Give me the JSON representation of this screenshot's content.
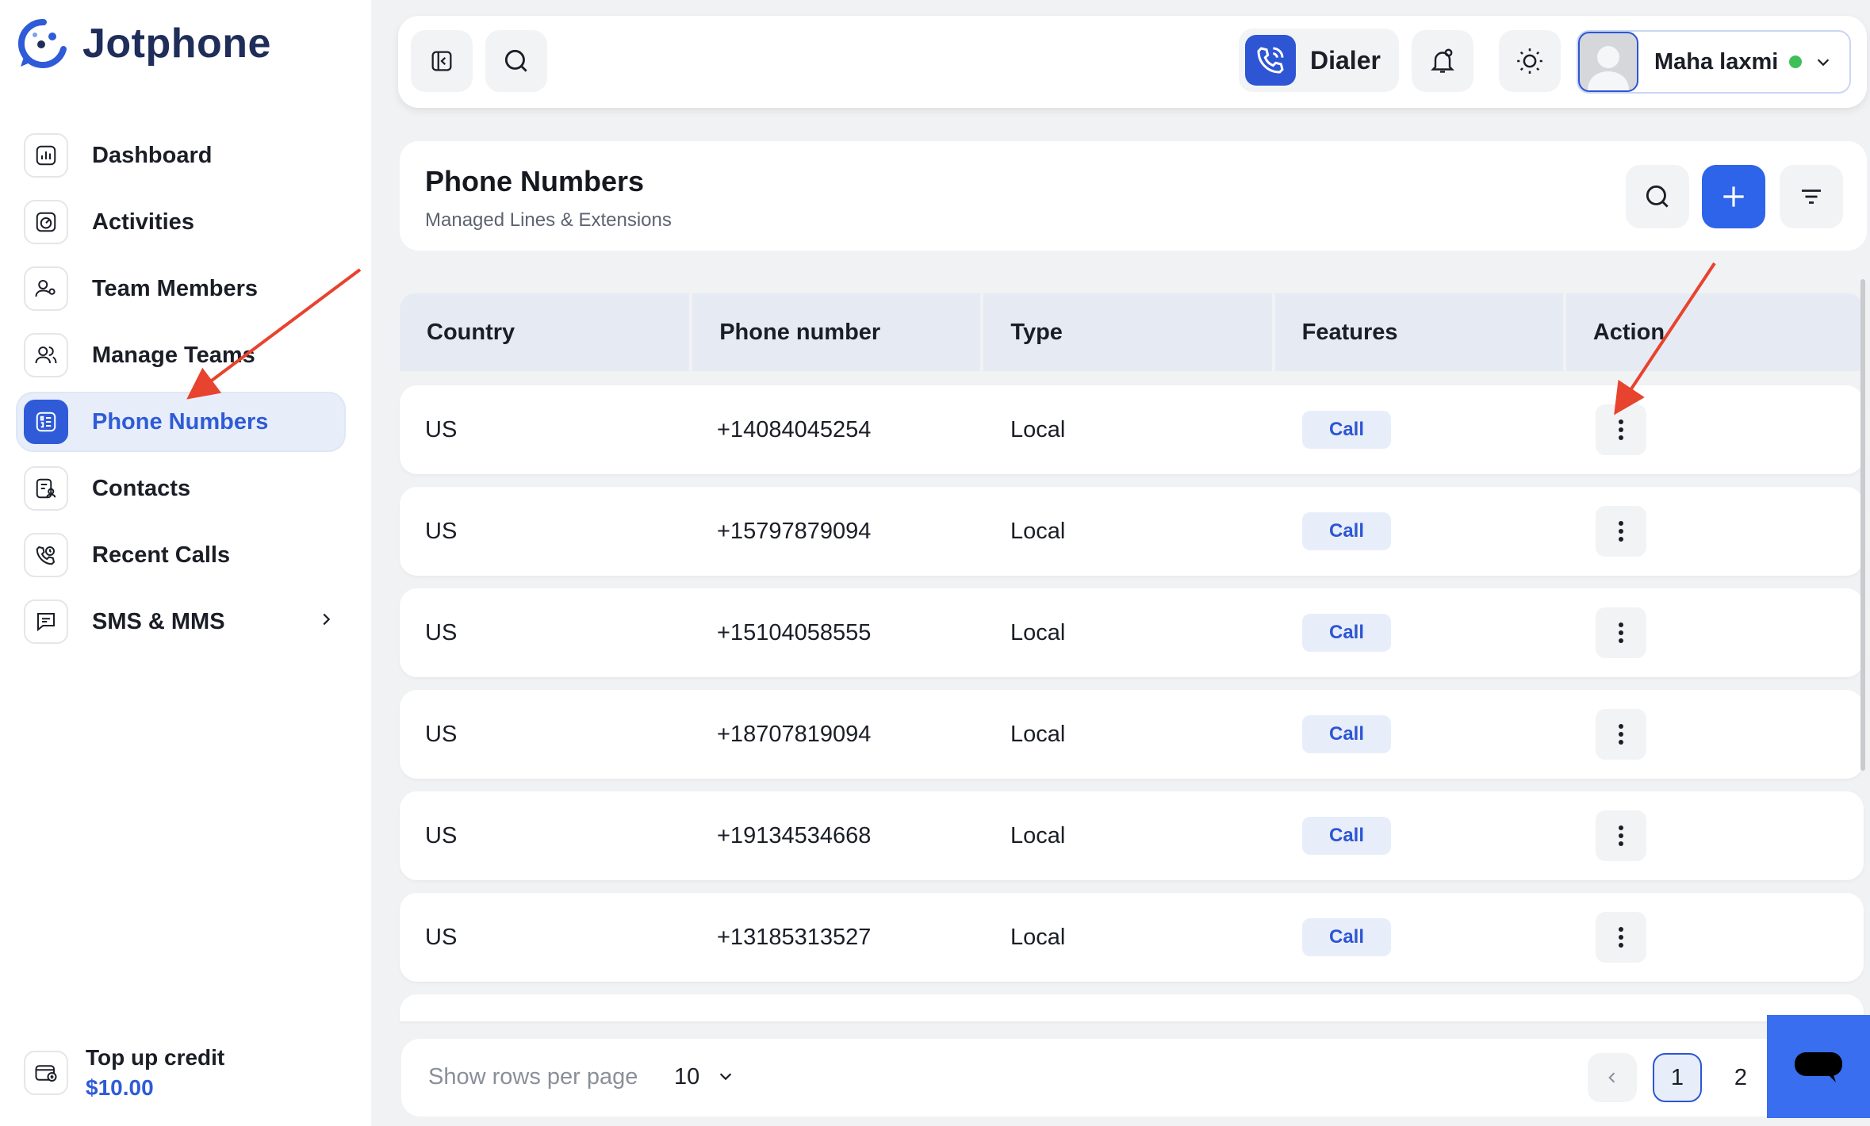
{
  "brand": {
    "name": "Jotphone",
    "accent": "#2f5bd8"
  },
  "sidebar": {
    "items": [
      {
        "label": "Dashboard",
        "icon": "chart-bars-icon",
        "active": false
      },
      {
        "label": "Activities",
        "icon": "speedometer-icon",
        "active": false
      },
      {
        "label": "Team Members",
        "icon": "user-gear-icon",
        "active": false
      },
      {
        "label": "Manage Teams",
        "icon": "users-icon",
        "active": false
      },
      {
        "label": "Phone Numbers",
        "icon": "phone-list-icon",
        "active": true
      },
      {
        "label": "Contacts",
        "icon": "contact-card-icon",
        "active": false
      },
      {
        "label": "Recent Calls",
        "icon": "phone-history-icon",
        "active": false
      },
      {
        "label": "SMS & MMS",
        "icon": "message-icon",
        "active": false,
        "has_submenu": true
      }
    ],
    "topup": {
      "label": "Top up credit",
      "amount": "$10.00"
    }
  },
  "header": {
    "dialer_label": "Dialer",
    "user_name": "Maha laxmi",
    "user_status": "online"
  },
  "page": {
    "title": "Phone Numbers",
    "subtitle": "Managed Lines & Extensions"
  },
  "table": {
    "columns": [
      "Country",
      "Phone number",
      "Type",
      "Features",
      "Action"
    ],
    "rows": [
      {
        "country": "US",
        "phone": "+14084045254",
        "type": "Local",
        "feature": "Call"
      },
      {
        "country": "US",
        "phone": "+15797879094",
        "type": "Local",
        "feature": "Call"
      },
      {
        "country": "US",
        "phone": "+15104058555",
        "type": "Local",
        "feature": "Call"
      },
      {
        "country": "US",
        "phone": "+18707819094",
        "type": "Local",
        "feature": "Call"
      },
      {
        "country": "US",
        "phone": "+19134534668",
        "type": "Local",
        "feature": "Call"
      },
      {
        "country": "US",
        "phone": "+13185313527",
        "type": "Local",
        "feature": "Call"
      }
    ]
  },
  "footer": {
    "rows_label": "Show rows per page",
    "rows_value": "10",
    "pages": [
      "1",
      "2"
    ],
    "current_page": "1"
  },
  "annotation_color": "#e8432e"
}
